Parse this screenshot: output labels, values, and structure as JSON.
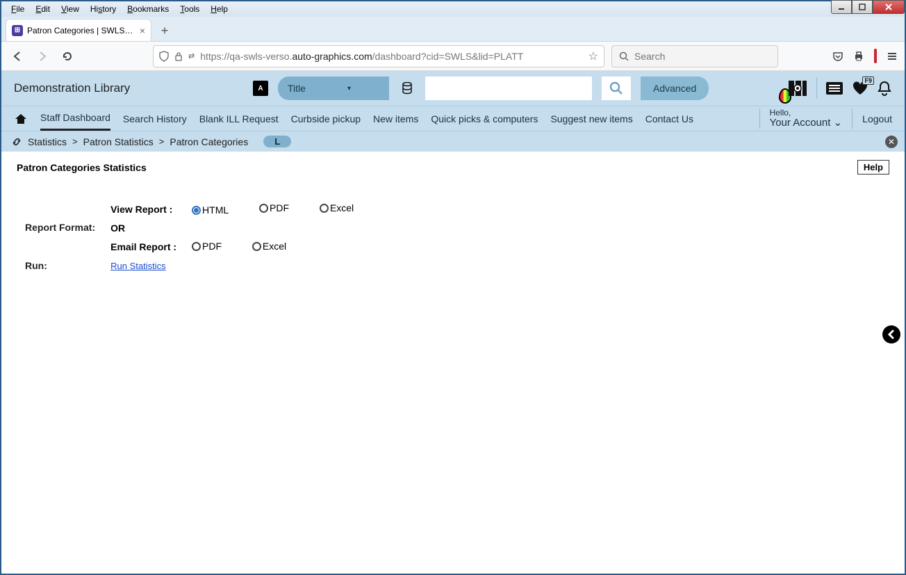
{
  "menubar": [
    "File",
    "Edit",
    "View",
    "History",
    "Bookmarks",
    "Tools",
    "Help"
  ],
  "tab": {
    "title": "Patron Categories | SWLS | platt"
  },
  "url": {
    "prefix": "https://qa-swls-verso.",
    "domain": "auto-graphics.com",
    "path": "/dashboard?cid=SWLS&lid=PLATT"
  },
  "browser_search_placeholder": "Search",
  "library_name": "Demonstration Library",
  "search_type": "Title",
  "advanced_label": "Advanced",
  "heart_badge": "F9",
  "nav": {
    "items": [
      "Staff Dashboard",
      "Search History",
      "Blank ILL Request",
      "Curbside pickup",
      "New items",
      "Quick picks & computers",
      "Suggest new items",
      "Contact Us"
    ],
    "hello": "Hello,",
    "account": "Your Account",
    "logout": "Logout"
  },
  "breadcrumb": {
    "segs": [
      "Statistics",
      "Patron Statistics",
      "Patron Categories"
    ],
    "badge": "L"
  },
  "page": {
    "title": "Patron Categories Statistics",
    "help": "Help"
  },
  "form": {
    "report_format_label": "Report Format:",
    "view_report_label": "View Report :",
    "or_label": "OR",
    "email_report_label": "Email Report :",
    "view_options": {
      "html": "HTML",
      "pdf": "PDF",
      "excel": "Excel"
    },
    "email_options": {
      "pdf": "PDF",
      "excel": "Excel"
    },
    "run_label": "Run:",
    "run_link": "Run Statistics"
  }
}
